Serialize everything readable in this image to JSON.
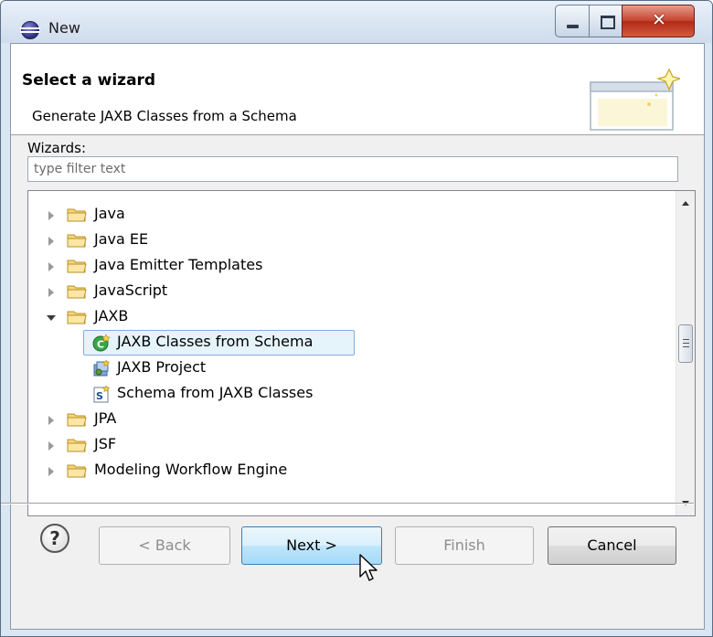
{
  "window": {
    "title": "New"
  },
  "header": {
    "title": "Select a wizard",
    "description": "Generate JAXB Classes from a Schema"
  },
  "filter": {
    "label": "Wizards:",
    "placeholder": "type filter text",
    "value": ""
  },
  "tree": {
    "items": [
      {
        "label": "Java",
        "expanded": false,
        "icon": "folder-icon"
      },
      {
        "label": "Java EE",
        "expanded": false,
        "icon": "folder-icon"
      },
      {
        "label": "Java Emitter Templates",
        "expanded": false,
        "icon": "folder-icon"
      },
      {
        "label": "JavaScript",
        "expanded": false,
        "icon": "folder-icon"
      },
      {
        "label": "JAXB",
        "expanded": true,
        "icon": "folder-icon",
        "children": [
          {
            "label": "JAXB Classes from Schema",
            "selected": true,
            "icon": "jaxb-classes-icon"
          },
          {
            "label": "JAXB Project",
            "icon": "jaxb-project-icon"
          },
          {
            "label": "Schema from JAXB Classes",
            "icon": "schema-icon"
          }
        ]
      },
      {
        "label": "JPA",
        "expanded": false,
        "icon": "folder-icon"
      },
      {
        "label": "JSF",
        "expanded": false,
        "icon": "folder-icon"
      },
      {
        "label": "Modeling Workflow Engine",
        "expanded": false,
        "icon": "folder-icon"
      }
    ]
  },
  "buttons": {
    "help": "?",
    "back": "< Back",
    "next": "Next >",
    "finish": "Finish",
    "cancel": "Cancel"
  },
  "colors": {
    "selection": "#e5f3fb",
    "selection_border": "#84acdd",
    "default_button": "#bee6fd",
    "close_button": "#c4422d"
  }
}
